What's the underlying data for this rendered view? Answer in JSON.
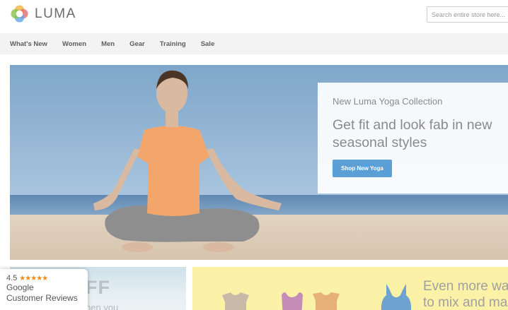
{
  "header": {
    "brand": "LUMA",
    "search_placeholder": "Search entire store here..."
  },
  "nav": {
    "items": [
      "What's New",
      "Women",
      "Men",
      "Gear",
      "Training",
      "Sale"
    ]
  },
  "hero": {
    "kicker": "New Luma Yoga Collection",
    "title": "Get fit and look fab in new seasonal styles",
    "button_label": "Shop New Yoga"
  },
  "promos": {
    "left_headline": "FF",
    "left_subline": "hen you",
    "right_line1": "Even more wa",
    "right_line2": "to mix and ma"
  },
  "reviews_badge": {
    "score": "4.5",
    "stars": "★★★★★",
    "line1": "Google",
    "line2": "Customer Reviews"
  },
  "colors": {
    "accent": "#5a9fd6",
    "star": "#e8901a",
    "nav_bg": "#f3f3f3"
  },
  "icons": [
    "luma-logo-icon",
    "star-icon"
  ]
}
